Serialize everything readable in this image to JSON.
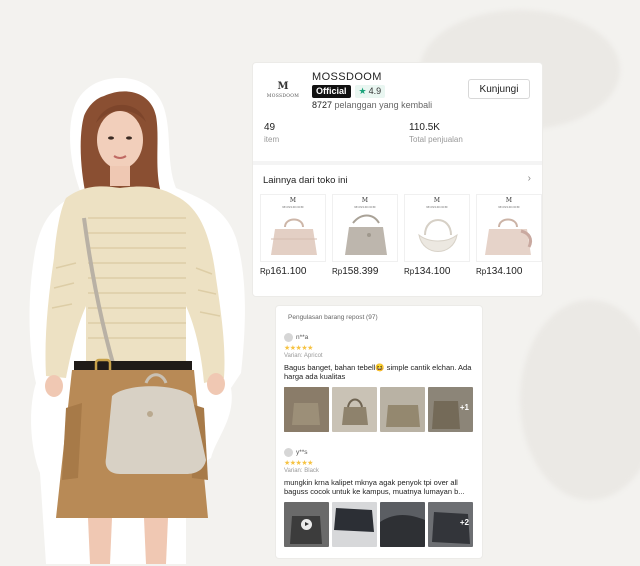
{
  "store": {
    "name": "MOSSDOOM",
    "logo_mark": "M",
    "logo_word": "MOSSDOOM",
    "official_label": "Official",
    "rating": "4.9",
    "returning_count": "8727",
    "returning_label": "pelanggan yang kembali",
    "visit_label": "Kunjungi",
    "stats": [
      {
        "value": "49",
        "label": "item"
      },
      {
        "value": "110.5K",
        "label": "Total penjualan"
      }
    ],
    "more_title": "Lainnya dari toko ini",
    "more_chevron_icon": "chevron-right-icon",
    "products": [
      {
        "currency": "Rp",
        "amount": "161.100",
        "color": "#e3cfc4"
      },
      {
        "currency": "Rp",
        "amount": "158.399",
        "color": "#bdb6ad"
      },
      {
        "currency": "Rp",
        "amount": "134.100",
        "color": "#ece8e1"
      },
      {
        "currency": "Rp",
        "amount": "134.100",
        "color": "#e6d3c9"
      }
    ]
  },
  "reviews": {
    "title": "Pengulasan barang repost (97)",
    "items": [
      {
        "user": "n**a",
        "stars": "★★★★★",
        "variant": "Varian: Apricot",
        "text": "Bagus banget, bahan tebell😆 simple cantik elchan. Ada harga ada kualitas",
        "photo_extra": "+1"
      },
      {
        "user": "y**s",
        "stars": "★★★★★",
        "variant": "Varian: Black",
        "text": "mungkin krna kalipet mknya agak penyok tpi over all baguss cocok untuk ke kampus, muatnya lumayan b...",
        "photo_extra": "+2"
      }
    ]
  },
  "colors": {
    "accent_green": "#1aa37a",
    "star_yellow": "#f6c343",
    "background": "#f3f2ef"
  }
}
